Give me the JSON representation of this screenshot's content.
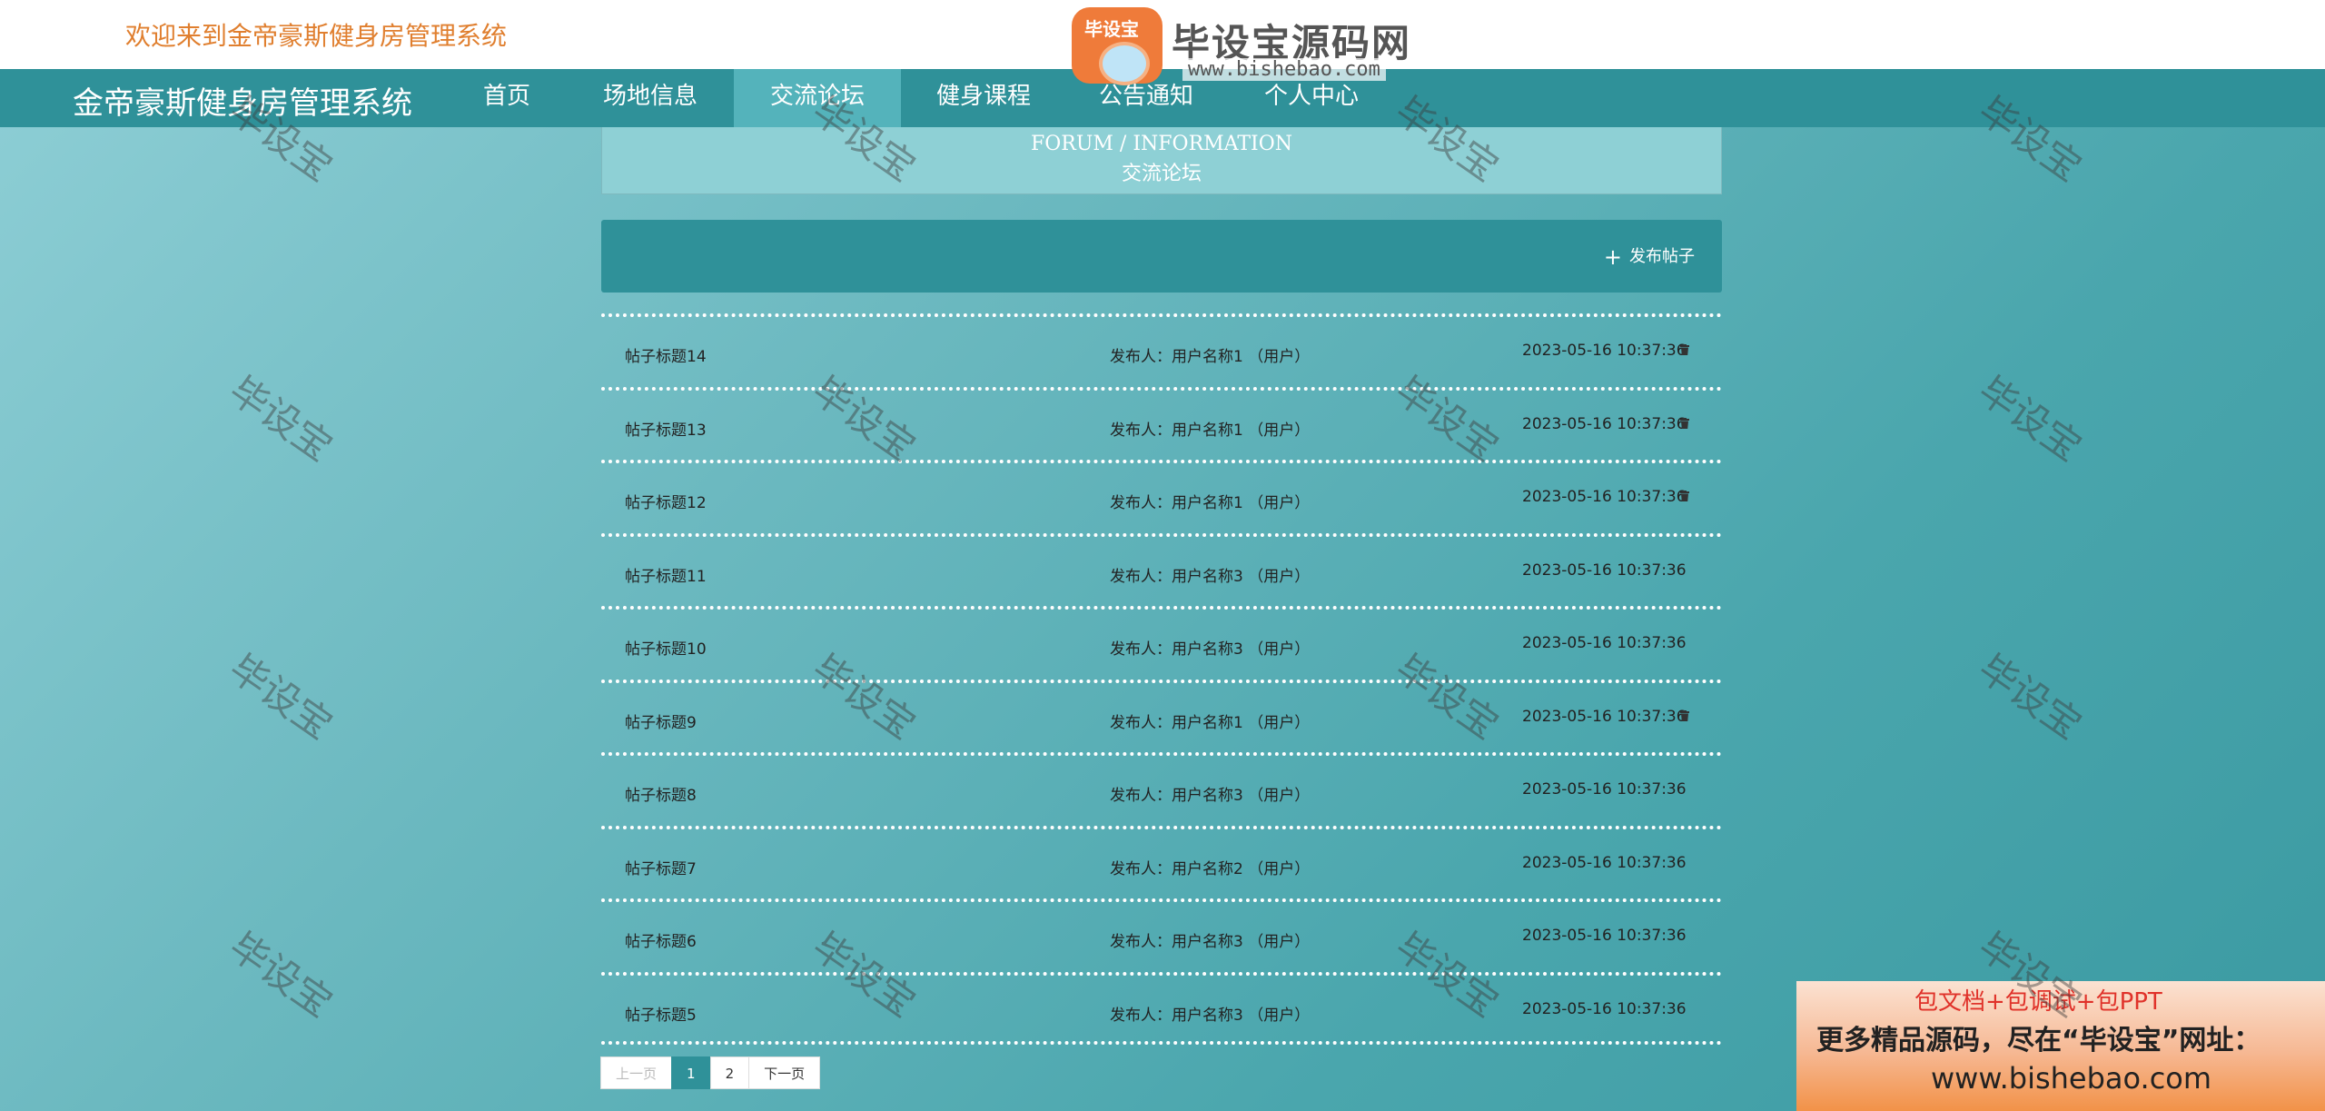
{
  "header": {
    "welcome": "欢迎来到金帝豪斯健身房管理系统",
    "brand": "金帝豪斯健身房管理系统"
  },
  "nav": {
    "items": [
      {
        "label": "首页"
      },
      {
        "label": "场地信息"
      },
      {
        "label": "交流论坛"
      },
      {
        "label": "健身课程"
      },
      {
        "label": "公告通知"
      },
      {
        "label": "个人中心"
      }
    ],
    "active_index": 2
  },
  "logo": {
    "badge": "毕设宝",
    "name": "毕设宝源码网",
    "url": "www.bishebao.com"
  },
  "forum": {
    "title_en": "FORUM / INFORMATION",
    "title_cn": "交流论坛",
    "post_button": "发布帖子"
  },
  "posts": [
    {
      "title": "帖子标题14",
      "author": "发布人：用户名称1 （用户）",
      "time": "2023-05-16 10:37:36",
      "deletable": true
    },
    {
      "title": "帖子标题13",
      "author": "发布人：用户名称1 （用户）",
      "time": "2023-05-16 10:37:36",
      "deletable": true
    },
    {
      "title": "帖子标题12",
      "author": "发布人：用户名称1 （用户）",
      "time": "2023-05-16 10:37:36",
      "deletable": true
    },
    {
      "title": "帖子标题11",
      "author": "发布人：用户名称3 （用户）",
      "time": "2023-05-16 10:37:36",
      "deletable": false
    },
    {
      "title": "帖子标题10",
      "author": "发布人：用户名称3 （用户）",
      "time": "2023-05-16 10:37:36",
      "deletable": false
    },
    {
      "title": "帖子标题9",
      "author": "发布人：用户名称1 （用户）",
      "time": "2023-05-16 10:37:36",
      "deletable": true
    },
    {
      "title": "帖子标题8",
      "author": "发布人：用户名称3 （用户）",
      "time": "2023-05-16 10:37:36",
      "deletable": false
    },
    {
      "title": "帖子标题7",
      "author": "发布人：用户名称2 （用户）",
      "time": "2023-05-16 10:37:36",
      "deletable": false
    },
    {
      "title": "帖子标题6",
      "author": "发布人：用户名称3 （用户）",
      "time": "2023-05-16 10:37:36",
      "deletable": false
    },
    {
      "title": "帖子标题5",
      "author": "发布人：用户名称3 （用户）",
      "time": "2023-05-16 10:37:36",
      "deletable": false
    }
  ],
  "pagination": {
    "prev": "上一页",
    "pages": [
      "1",
      "2"
    ],
    "current": "1",
    "next": "下一页"
  },
  "ad": {
    "line1": "包文档+包调试+包PPT",
    "line2": "更多精品源码，尽在“毕设宝”网址：",
    "line3": "www.bishebao.com"
  },
  "watermark": "毕设宝",
  "colors": {
    "nav_bg": "#2f9199",
    "nav_active": "#54b3bb",
    "welcome_text": "#e07f2f",
    "ad_red": "#e0322a"
  }
}
